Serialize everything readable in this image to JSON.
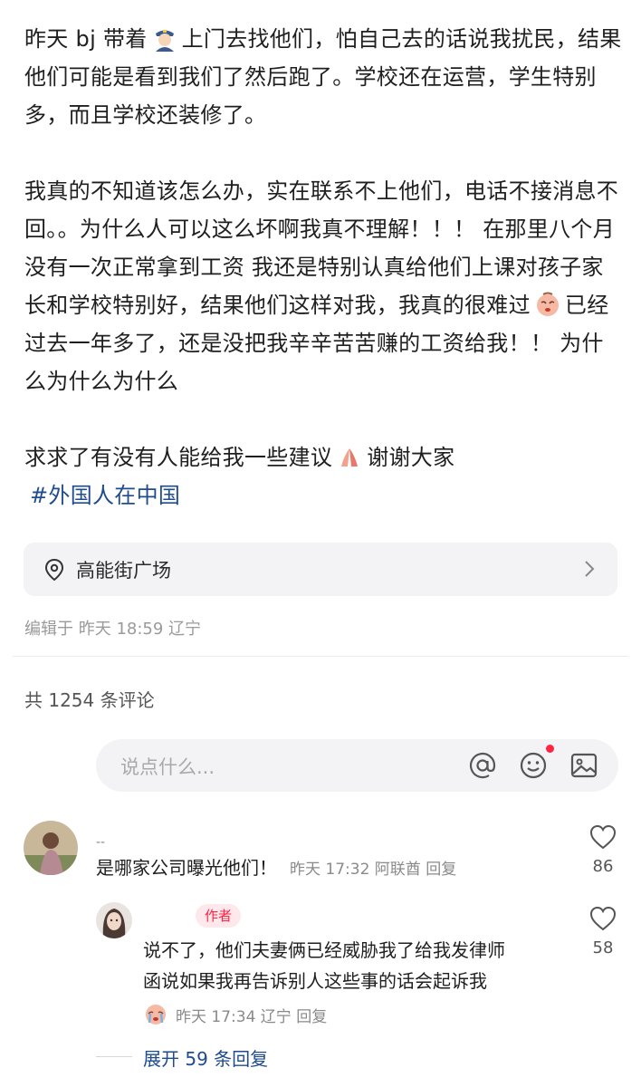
{
  "post": {
    "p1_a": "昨天 bj 带着",
    "p1_b": "上门去找他们，怕自己去的话说我扰民，结果他们可能是看到我们了然后跑了。学校还在运营，学生特别多，而且学校还装修了。",
    "p2_a": "我真的不知道该怎么办，实在联系不上他们，电话不接消息不回。。为什么人可以这么坏啊我真不理解！！！ 在那里八个月没有一次正常拿到工资 我还是特别认真给他们上课对孩子家长和学校特别好，结果他们这样对我，我真的很难过",
    "p2_b": "已经过去一年多了，还是没把我辛辛苦苦赚的工资给我！！ 为什么为什么为什么",
    "p3_a": "求求了有没有人能给我一些建议",
    "p3_b": "谢谢大家",
    "hashtag": "#外国人在中国"
  },
  "location": {
    "name": "高能街广场"
  },
  "edited": "编辑于 昨天 18:59 辽宁",
  "comments_count": "共 1254 条评论",
  "comment_box": {
    "placeholder": "说点什么..."
  },
  "icons": {
    "police": "police-officer-emoji",
    "sad": "sad-face-emoji",
    "pray": "praying-hands-emoji",
    "location": "location-pin-icon",
    "at": "at-icon",
    "emoji": "emoji-icon",
    "image": "image-icon",
    "heart": "heart-icon",
    "crying": "crying-face-emoji"
  },
  "comments": [
    {
      "name": "--",
      "text": "是哪家公司曝光他们！",
      "meta": "昨天 17:32 阿联酋 回复",
      "likes": "86"
    },
    {
      "name": "",
      "badge": "作者",
      "text_line1": "说不了，他们夫妻俩已经威胁我了给我发律师",
      "text_line2": "函说如果我再告诉别人这些事的话会起诉我",
      "meta": "昨天 17:34 辽宁 回复",
      "likes": "58"
    }
  ],
  "expand_label": "展开 59 条回复",
  "colors": {
    "accent_red": "#ff2442",
    "link_blue": "#1f4b8f"
  }
}
